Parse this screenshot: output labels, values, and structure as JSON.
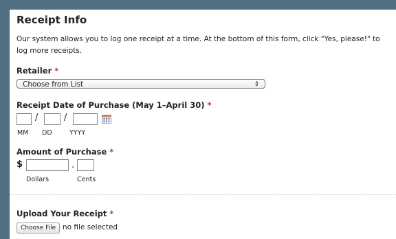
{
  "section": {
    "title": "Receipt Info",
    "intro": "Our system allows you to log one receipt at a time. At the bottom of this form, click \"Yes, please!\" to log more receipts."
  },
  "required_marker": "*",
  "retailer": {
    "label": "Retailer",
    "selected": "Choose from List",
    "arrows": "⇕"
  },
  "date": {
    "label": "Receipt Date of Purchase (May 1–April 30)",
    "separator": "/",
    "month_label": "MM",
    "day_label": "DD",
    "year_label": "YYYY",
    "month_value": "",
    "day_value": "",
    "year_value": ""
  },
  "amount": {
    "label": "Amount of Purchase",
    "currency": "$",
    "decimal": ".",
    "dollars_label": "Dollars",
    "cents_label": "Cents"
  },
  "upload": {
    "label": "Upload Your Receipt",
    "button": "Choose File",
    "status": "no file selected"
  },
  "colors": {
    "background": "#4f7182",
    "required": "#c0392b"
  }
}
